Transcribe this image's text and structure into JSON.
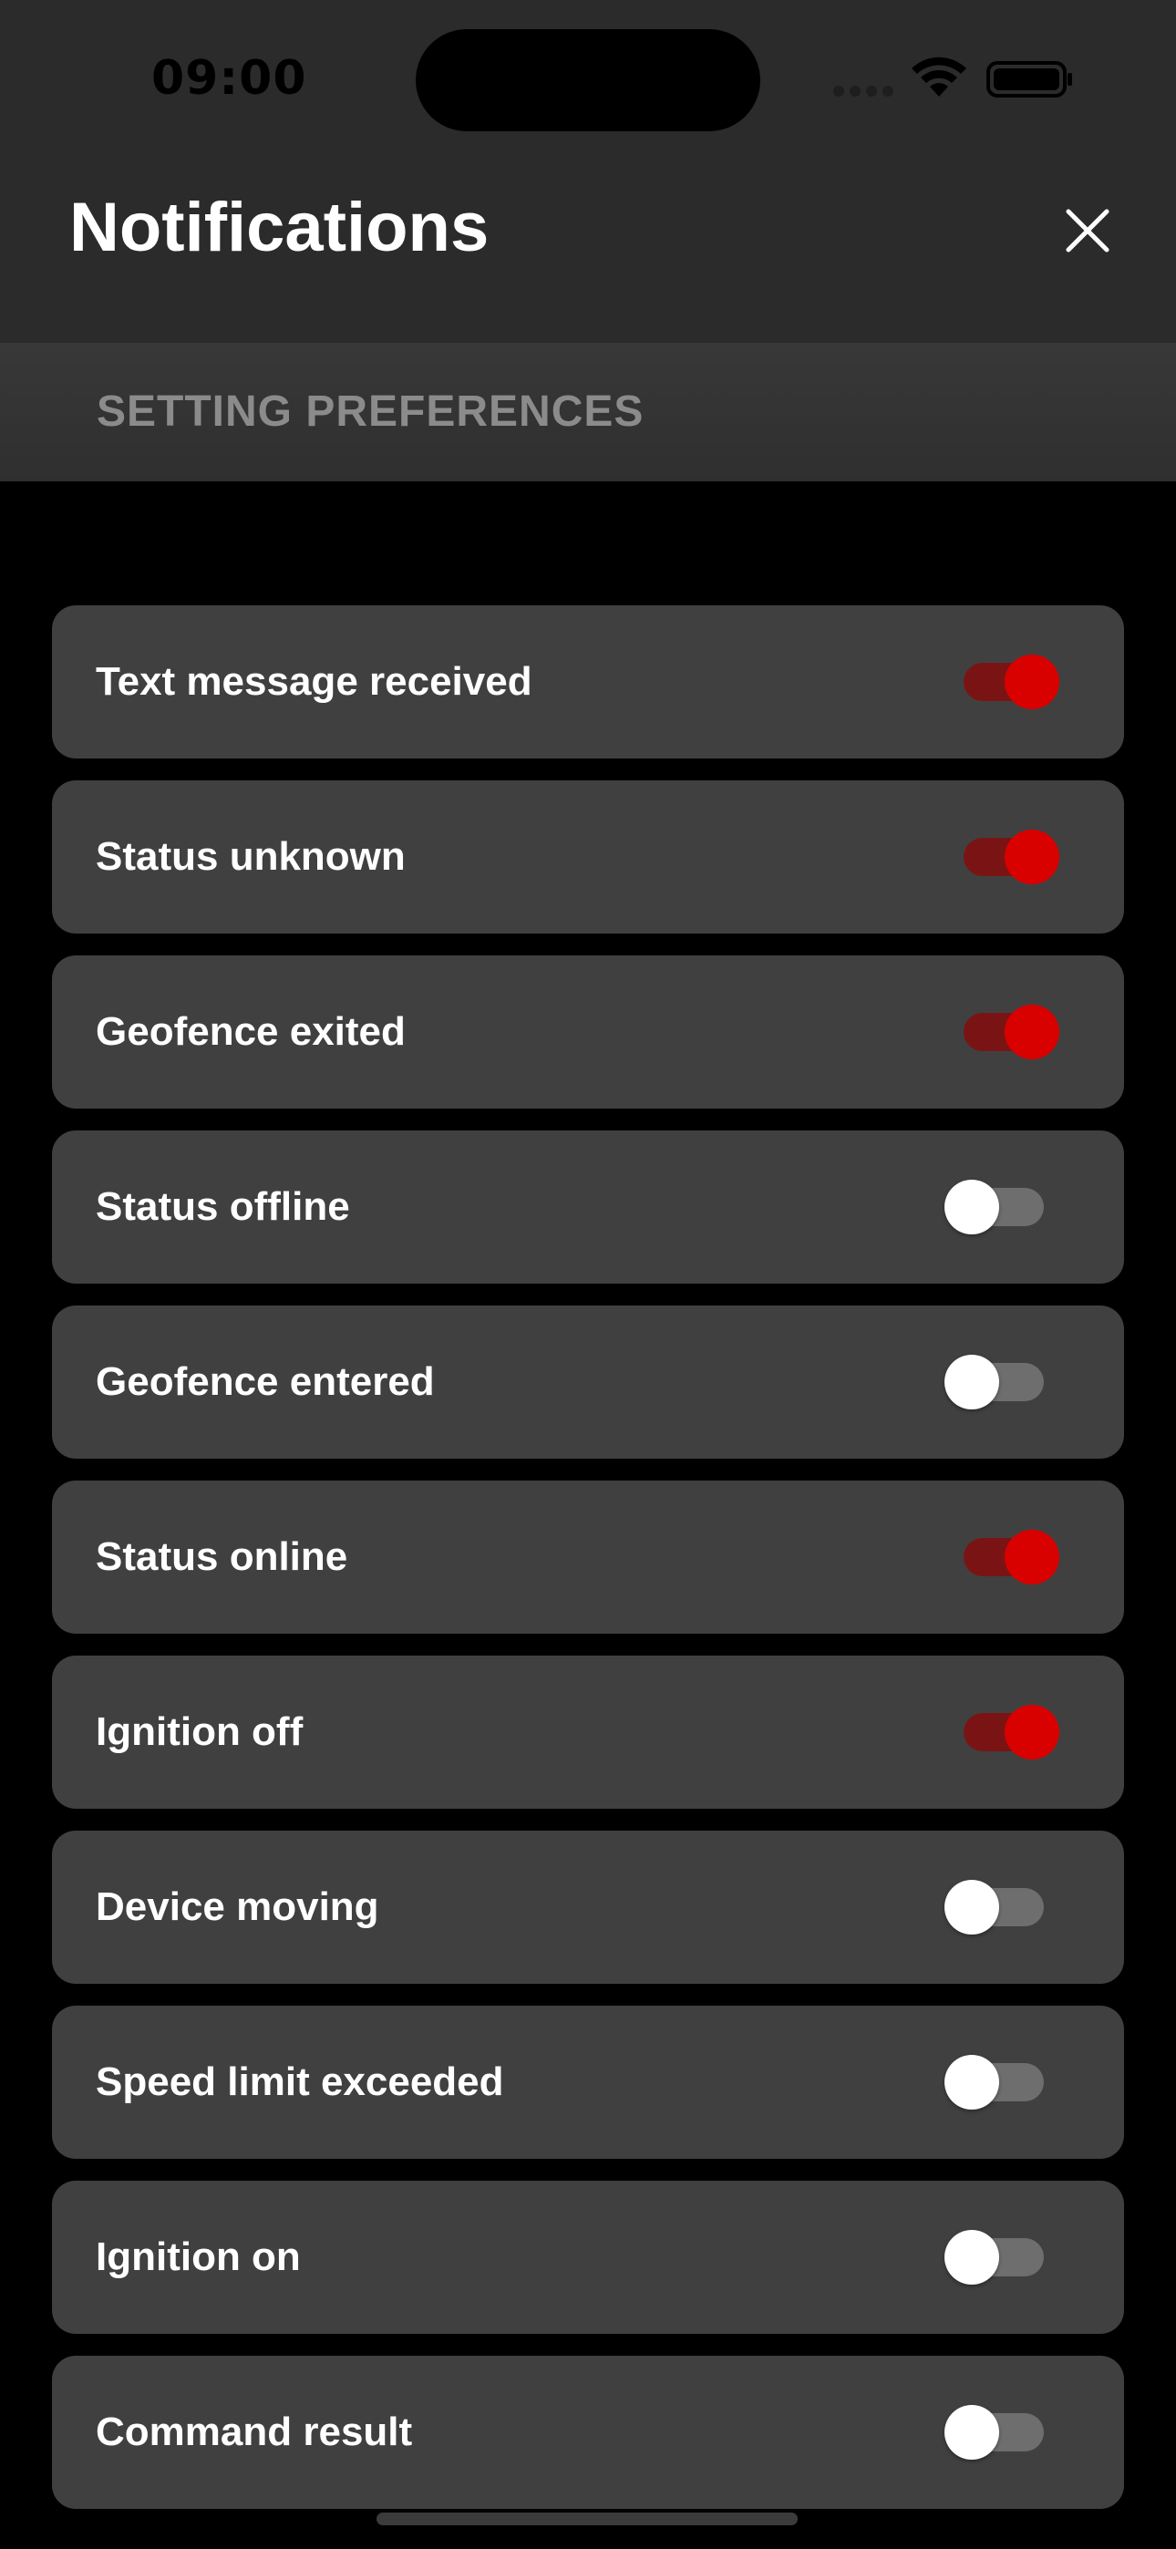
{
  "status_bar": {
    "time": "09:00",
    "signal_icon": "signal-icon",
    "wifi_icon": "wifi-icon",
    "battery_icon": "battery-icon"
  },
  "header": {
    "title": "Notifications",
    "close_icon": "close-icon"
  },
  "section": {
    "title": "SETTING PREFERENCES"
  },
  "colors": {
    "toggle_on_knob": "#d90000",
    "toggle_on_track": "#7a1414",
    "toggle_off_knob": "#ffffff",
    "toggle_off_track": "#6e6e6e",
    "row_background": "#404040"
  },
  "preferences": [
    {
      "label": "Text message received",
      "enabled": true
    },
    {
      "label": "Status unknown",
      "enabled": true
    },
    {
      "label": "Geofence exited",
      "enabled": true
    },
    {
      "label": "Status offline",
      "enabled": false
    },
    {
      "label": "Geofence entered",
      "enabled": false
    },
    {
      "label": "Status online",
      "enabled": true
    },
    {
      "label": "Ignition off",
      "enabled": true
    },
    {
      "label": "Device moving",
      "enabled": false
    },
    {
      "label": "Speed limit exceeded",
      "enabled": false
    },
    {
      "label": "Ignition on",
      "enabled": false
    },
    {
      "label": "Command result",
      "enabled": false
    }
  ]
}
